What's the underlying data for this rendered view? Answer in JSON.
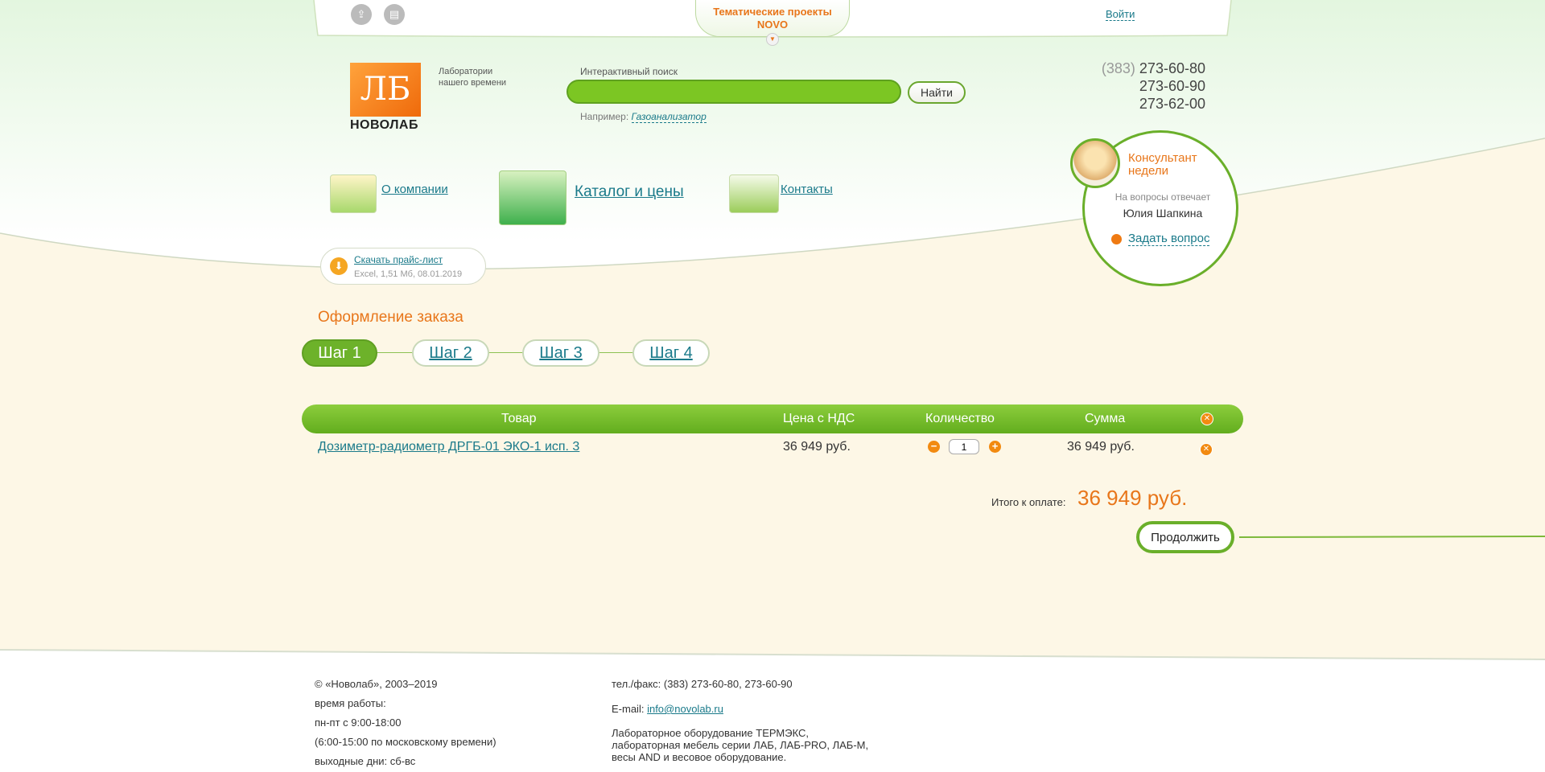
{
  "topbar": {
    "tab_line1": "Тематические проекты",
    "tab_line2": "NOVO",
    "login": "Войти"
  },
  "logo": {
    "mark": "ЛБ",
    "name": "НОВОЛАБ",
    "slogan": "Лаборатории нашего времени"
  },
  "search": {
    "label": "Интерактивный поиск",
    "value": "",
    "button": "Найти",
    "example_prefix": "Например:",
    "example_link": "Газоанализатор"
  },
  "phones": {
    "code": "(383)",
    "numbers": [
      "273-60-80",
      "273-60-90",
      "273-62-00"
    ]
  },
  "nav": {
    "about": "О компании",
    "catalog": "Каталог и цены",
    "contacts": "Контакты"
  },
  "pricelist": {
    "link": "Скачать прайс-лист",
    "meta": "Excel, 1,51 Мб, 08.01.2019"
  },
  "consultant": {
    "title": "Консультант недели",
    "subtitle": "На вопросы отвечает",
    "name": "Юлия Шапкина",
    "ask": "Задать вопрос"
  },
  "order": {
    "title": "Оформление заказа",
    "steps": [
      "Шаг 1",
      "Шаг 2",
      "Шаг 3",
      "Шаг 4"
    ],
    "active_step": 1
  },
  "table": {
    "headers": [
      "Товар",
      "Цена с НДС",
      "Количество",
      "Сумма"
    ],
    "rows": [
      {
        "product": "Дозиметр-радиометр ДРГБ-01 ЭКО-1 исп. 3",
        "price": "36 949 руб.",
        "quantity": "1",
        "sum": "36 949 руб."
      }
    ]
  },
  "total": {
    "label": "Итого к оплате:",
    "value": "36 949 руб."
  },
  "continue_button": "Продолжить",
  "footer": {
    "copyright": "© «Новолаб», 2003–2019",
    "hours_label": "время работы:",
    "hours_weekdays": "пн-пт с 9:00-18:00",
    "hours_moscow": "(6:00-15:00 по московскому времени)",
    "weekends": "выходные дни: сб-вс",
    "phone": "тел./факс: (383) 273-60-80, 273-60-90",
    "email_label": "E-mail:",
    "email": "info@novolab.ru",
    "description": "Лабораторное оборудование ТЕРМЭКС, лабораторная мебель серии ЛАБ, ЛАБ-PRO, ЛАБ-М, весы AND и весовое оборудование."
  },
  "colors": {
    "accent_orange": "#e8761a",
    "brand_green": "#6aaf2a",
    "link": "#1a7a8a",
    "cream_bg": "#fdf7e6"
  },
  "icons": [
    "login-icon",
    "print-icon",
    "chevron-down-icon",
    "download-icon",
    "close-icon",
    "minus-icon",
    "plus-icon"
  ]
}
